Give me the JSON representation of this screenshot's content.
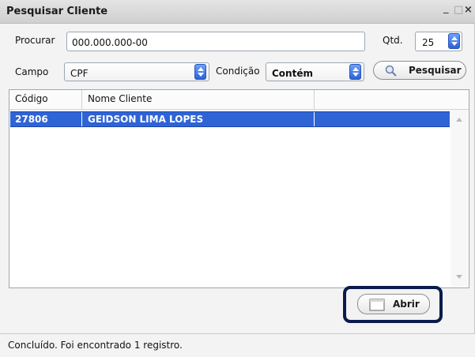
{
  "window": {
    "title": "Pesquisar Cliente",
    "controls": {
      "minimize": "_",
      "maximize": "□",
      "close": "×"
    }
  },
  "form": {
    "procurar_label": "Procurar",
    "procurar_value": "000.000.000-00",
    "qtd_label": "Qtd.",
    "qtd_value": "25",
    "campo_label": "Campo",
    "campo_value": "CPF",
    "condicao_label": "Condição",
    "condicao_value": "Contém",
    "pesquisar_label": "Pesquisar"
  },
  "table": {
    "columns": [
      "Código",
      "Nome Cliente",
      ""
    ],
    "rows": [
      {
        "codigo": "27806",
        "nome": "GEIDSON LIMA LOPES"
      }
    ]
  },
  "actions": {
    "abrir_label": "Abrir"
  },
  "status": {
    "text": "Concluído. Foi encontrado 1 registro."
  },
  "colors": {
    "selection": "#2f64d7",
    "highlight_border": "#0b1b4b",
    "spin": "#2b62d6"
  },
  "icons": {
    "search": "search-icon",
    "open": "open-window-icon"
  }
}
